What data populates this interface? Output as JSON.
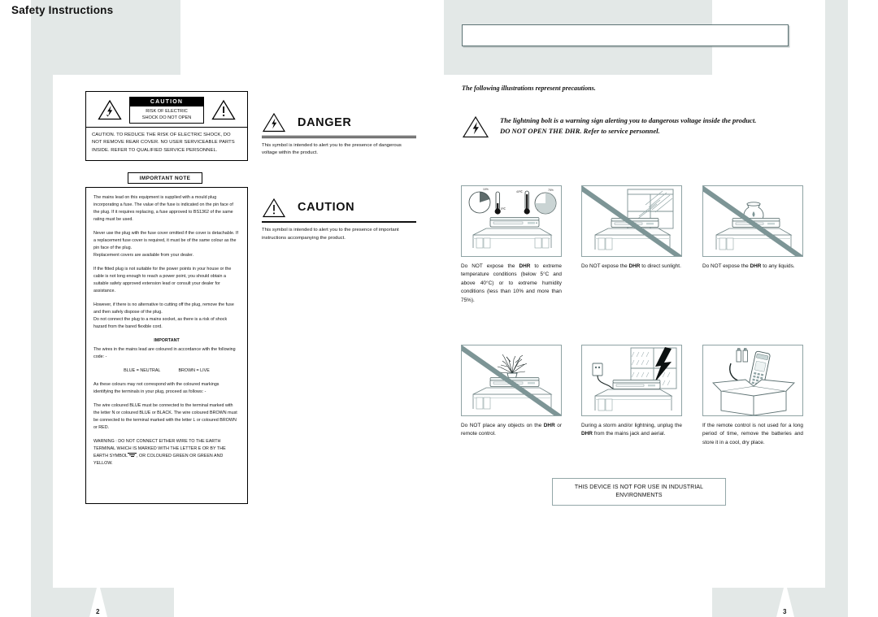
{
  "document": {
    "left_page_number": "2",
    "right_page_number": "3"
  },
  "header": {
    "title": "Safety Instructions"
  },
  "left_page": {
    "caution_label": "CAUTION",
    "caution_sub_line1": "RISK OF ELECTRIC",
    "caution_sub_line2": "SHOCK DO NOT OPEN",
    "caution_body": "CAUTION. TO REDUCE THE RISK OF ELECTRIC SHOCK, DO NOT REMOVE REAR COVER. NO USER SERVICEABLE PARTS INSIDE. REFER TO QUALIFIED SERVICE PERSONNEL.",
    "important_note_label": "IMPORTANT NOTE",
    "note_paragraphs": [
      "The mains lead on this equipment is supplied with a mould plug incorporating a fuse. The value of the fuse is indicated on the pin face of the plug. If it requires replacing, a fuse approved to BS1362 of the same rating must be used.",
      "Never use the plug with the fuse cover omitted if the cover is detachable. If a replacement fuse cover is required, it must be of the same colour as the pin face of the plug.",
      "Replacement covers are available from your dealer.",
      "If the fitted plug is not suitable for the power points in your house or the cable is not long enough to reach a power point, you should obtain a suitable safety approved extension lead or consult your dealer for assistance.",
      "However, if there is no alternative to cutting off the plug, remove the fuse and then safely dispose of the plug.",
      "Do not connect the plug to a mains socket, as there is a risk of shock hazard from the bared flexible cord."
    ],
    "important_heading": "IMPORTANT",
    "important_intro": "The wires in the mains lead are coloured in accordance with the following code: -",
    "wire_blue": "BLUE = NEUTRAL",
    "wire_brown": "BROWN = LIVE",
    "colour_mismatch": "As these colours may not correspond with the coloured markings identifying the terminals in your plug, proceed as follows: -",
    "wire_instructions": "The wire coloured BLUE must be connected to the terminal marked with the letter N or coloured BLUE or BLACK. The wire coloured BROWN must be connected to the terminal marked with the letter L or coloured BROWN or RED.",
    "warning_part1": "WARNING : DO NOT CONNECT EITHER WIRE TO THE EARTH TERMINAL WHICH IS MARKED WITH THE LETTER E OR BY THE EARTH SYMBOL",
    "warning_part2": ", OR COLOURED GREEN OR GREEN AND YELLOW."
  },
  "symbols": {
    "danger_label": "DANGER",
    "danger_text": "This symbol is intended to alert you to the presence of dangerous voltage within the product.",
    "caution_label": "CAUTION",
    "caution_text": "This symbol is intended to alert you to the presence of important instructions accompanying the product."
  },
  "right_page": {
    "intro": "The following illustrations represent precautions.",
    "bolt_note_line1": "The lightning bolt is a warning sign alerting you to dangerous voltage inside the product.",
    "bolt_note_line2": "DO NOT OPEN THE DHR. Refer to service personnel.",
    "industrial_line1": "THIS DEVICE IS NOT FOR USE IN INDUSTRIAL",
    "industrial_line2": "ENVIRONMENTS",
    "panels": [
      {
        "id": "temperature-humidity",
        "caption_pre": "Do NOT expose the ",
        "caption_bold": "DHR",
        "caption_post": " to extreme temperature conditions (below 5°C and above 40°C) or to extreme humidity conditions (less than 10% and more than 75%).",
        "slashed": false
      },
      {
        "id": "direct-sunlight",
        "caption_pre": "Do NOT expose the ",
        "caption_bold": "DHR",
        "caption_post": " to direct sunlight.",
        "slashed": true
      },
      {
        "id": "liquids",
        "caption_pre": "Do NOT expose the ",
        "caption_bold": "DHR",
        "caption_post": " to any liquids.",
        "slashed": true
      },
      {
        "id": "objects-on-top",
        "caption_pre": "Do NOT place any objects on the ",
        "caption_bold": "DHR",
        "caption_post": " or remote control.",
        "slashed": true
      },
      {
        "id": "storm-unplug",
        "caption_pre": "During a storm and/or lightning, unplug the ",
        "caption_bold": "DHR",
        "caption_post": " from the mains jack and aerial.",
        "slashed": false
      },
      {
        "id": "remote-battery-storage",
        "caption_pre": "If the remote control is not used for a long period of time, remove the batteries and store it in a cool, dry place.",
        "caption_bold": "",
        "caption_post": "",
        "slashed": false
      }
    ]
  },
  "colors": {
    "page_gray": "#e3e8e7",
    "slash_teal": "#7d9596",
    "frame_teal": "#8fa3a4",
    "ink": "#111111"
  }
}
